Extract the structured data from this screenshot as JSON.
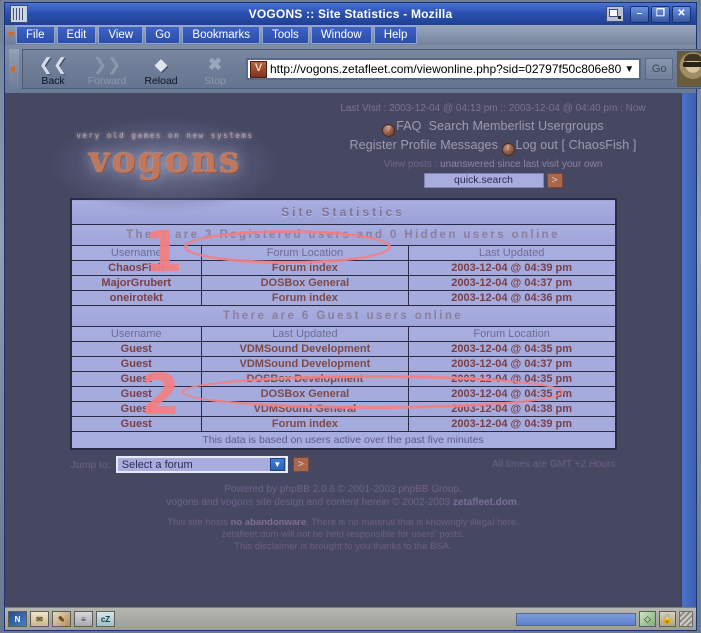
{
  "window": {
    "title": "VOGONS :: Site Statistics - Mozilla",
    "app_icon": "mozilla-icon",
    "restore_icon": "restore-icon",
    "minimize_label": "–",
    "maximize_label": "❐",
    "close_label": "✕"
  },
  "menubar": {
    "items": [
      {
        "label": "File",
        "accel": "F"
      },
      {
        "label": "Edit",
        "accel": "E"
      },
      {
        "label": "View",
        "accel": "V"
      },
      {
        "label": "Go",
        "accel": "G"
      },
      {
        "label": "Bookmarks",
        "accel": "B"
      },
      {
        "label": "Tools",
        "accel": "T"
      },
      {
        "label": "Window",
        "accel": "W"
      },
      {
        "label": "Help",
        "accel": "H"
      }
    ]
  },
  "toolbar": {
    "back_label": "Back",
    "forward_label": "Forward",
    "reload_label": "Reload",
    "stop_label": "Stop",
    "url": "http://vogons.zetafleet.com/viewonline.php?sid=02797f50c806e80",
    "go_label": "Go",
    "dropdown_glyph": "▼"
  },
  "page": {
    "logo": {
      "tagline": "very old games on new systems",
      "wordmark": "vogons"
    },
    "last_visit": "Last Visit : 2003-12-04 @ 04:13 pm :: 2003-12-04 @ 04:40 pm : Now",
    "nav_links": [
      {
        "label": "FAQ",
        "icon": "faq-icon",
        "glyph": "?"
      },
      {
        "label": "Search",
        "icon": "search-icon",
        "glyph": "s"
      },
      {
        "label": "Memberlist",
        "icon": "memberlist-icon",
        "glyph": "m"
      },
      {
        "label": "Usergroups",
        "icon": "usergroups-icon",
        "glyph": "u"
      },
      {
        "label": "Register",
        "icon": "register-icon",
        "glyph": "r"
      },
      {
        "label": "Profile",
        "icon": "profile-icon",
        "glyph": "p"
      },
      {
        "label": "Messages",
        "icon": "messages-icon",
        "glyph": "m"
      },
      {
        "label": "Log out [ ChaosFish ]",
        "icon": "logout-icon",
        "glyph": "l"
      }
    ],
    "view_posts": {
      "prefix": "View posts :",
      "links": [
        "unanswered",
        "since last visit",
        "your own"
      ]
    },
    "quick_search": {
      "value": "quick.search",
      "placeholder": "quick.search",
      "go_glyph": ">"
    },
    "stats": {
      "title": "Site Statistics",
      "registered_banner": "There are 3 Registered users and 0 Hidden users online",
      "registered_headers": [
        "Username",
        "Forum Location",
        "Last Updated"
      ],
      "registered_rows": [
        {
          "username": "ChaosFish",
          "location": "Forum index",
          "updated": "2003-12-04 @ 04:39 pm"
        },
        {
          "username": "MajorGrubert",
          "location": "DOSBox General",
          "updated": "2003-12-04 @ 04:37 pm"
        },
        {
          "username": "oneirotekt",
          "location": "Forum index",
          "updated": "2003-12-04 @ 04:36 pm"
        }
      ],
      "guest_banner": "There are 6 Guest users online",
      "guest_headers": [
        "Username",
        "Last Updated",
        "Forum Location"
      ],
      "guest_rows": [
        {
          "username": "Guest",
          "location": "VDMSound Development",
          "updated": "2003-12-04 @ 04:35 pm"
        },
        {
          "username": "Guest",
          "location": "VDMSound Development",
          "updated": "2003-12-04 @ 04:37 pm"
        },
        {
          "username": "Guest",
          "location": "DOSBox Development",
          "updated": "2003-12-04 @ 04:35 pm"
        },
        {
          "username": "Guest",
          "location": "DOSBox General",
          "updated": "2003-12-04 @ 04:35 pm"
        },
        {
          "username": "Guest",
          "location": "VDMSound General",
          "updated": "2003-12-04 @ 04:38 pm"
        },
        {
          "username": "Guest",
          "location": "Forum index",
          "updated": "2003-12-04 @ 04:39 pm"
        }
      ],
      "footer_note": "This data is based on users active over the past five minutes"
    },
    "jump": {
      "label": "Jump to:",
      "selected": "Select a forum",
      "dropdown_glyph": "▼",
      "go_glyph": ">",
      "gmt": "All times are GMT +2 Hours"
    },
    "footer": {
      "line1_pre": "Powered by phpBB 2.0.6 © 2001-2003 phpBB Group.",
      "line2_pre": "vogons and vogons site design and content herein © 2002-2003 ",
      "line2_link": "zetafleet.dom",
      "line2_post": ".",
      "disclaimer1_pre": "This site hosts ",
      "disclaimer1_strong": "no abandonware",
      "disclaimer1_post": ". There is no material that is knowingly illegal here.",
      "disclaimer2": "zetafleet.dom will not be held responsible for users' posts.",
      "disclaimer3": "This disclaimer is brought to you thanks to the BSA."
    }
  },
  "annotations": [
    {
      "label": "1",
      "target": "site-statistics-title"
    },
    {
      "label": "2",
      "target": "guest-table-headers"
    }
  ],
  "statusbar": {
    "icons": [
      {
        "name": "navigator-icon",
        "glyph": "N"
      },
      {
        "name": "mail-icon",
        "glyph": "✉"
      },
      {
        "name": "composer-icon",
        "glyph": "✎"
      },
      {
        "name": "addressbook-icon",
        "glyph": "≡"
      },
      {
        "name": "chatzilla-icon",
        "glyph": "cZ"
      }
    ],
    "message": "",
    "secure_icon": "security-icon",
    "lock_icon": "padlock-icon",
    "resize_grip": "resize-grip"
  },
  "colors": {
    "title_bar": "#2c51b4",
    "page_bg": "#464862",
    "table_row": "#a5abdd",
    "table_header": "#a8ade0",
    "data_text": "#7a3f46",
    "annotation": "#f47f82",
    "logo": "#c1775c"
  }
}
